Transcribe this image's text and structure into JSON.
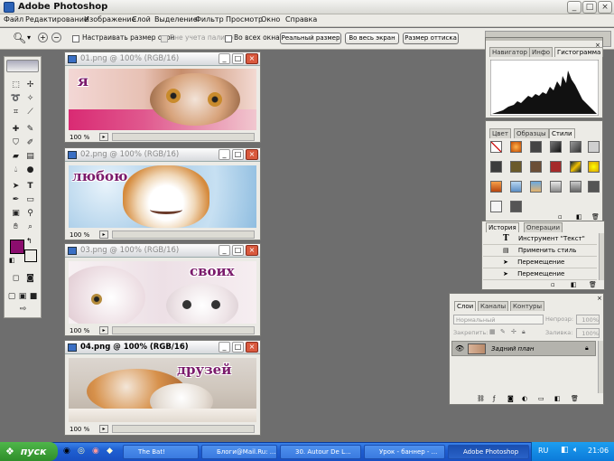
{
  "app": {
    "title": "Adobe Photoshop",
    "window_buttons": [
      "_",
      "□",
      "×"
    ]
  },
  "menu": [
    "Файл",
    "Редактирование",
    "Изображение",
    "Слой",
    "Выделение",
    "Фильтр",
    "Просмотр",
    "Окно",
    "Справка"
  ],
  "options_bar": {
    "resize_windows_label": "Настраивать размер окон",
    "ignore_palettes_label": "Вне учета палитр",
    "all_windows_label": "Во всех окнах",
    "actual_pixels": "Реальный размер",
    "fit_screen": "Во весь экран",
    "print_size": "Размер оттиска"
  },
  "documents": [
    {
      "title": "01.png @ 100% (RGB/16)",
      "zoom": "100 %",
      "caption": "я"
    },
    {
      "title": "02.png @ 100% (RGB/16)",
      "zoom": "100 %",
      "caption": "любою"
    },
    {
      "title": "03.png @ 100% (RGB/16)",
      "zoom": "100 %",
      "caption": "своих"
    },
    {
      "title": "04.png @ 100% (RGB/16)",
      "zoom": "100 %",
      "caption": "друзей"
    }
  ],
  "navigator_panel": {
    "tabs": [
      "Навигатор",
      "Инфо",
      "Гистограмма"
    ],
    "active": "Гистограмма"
  },
  "swatches_panel": {
    "tabs": [
      "Цвет",
      "Образцы",
      "Стили"
    ],
    "active": "Стили"
  },
  "history_panel": {
    "tabs": [
      "История",
      "Операции"
    ],
    "items": [
      "Инструмент \"Текст\"",
      "Применить стиль",
      "Перемещение",
      "Перемещение"
    ]
  },
  "layers_panel": {
    "tabs": [
      "Слои",
      "Каналы",
      "Контуры"
    ],
    "blend_mode": "Нормальный",
    "opacity_label": "Непрозр:",
    "opacity_value": "100%",
    "lock_label": "Закрепить:",
    "fill_label": "Заливка:",
    "fill_value": "100%",
    "layer_name": "Задний план"
  },
  "colors": {
    "foreground": "#8b0d6e",
    "background": "#ffffff",
    "desktop": "#6e6e6e",
    "caption_text": "#7a1a6b"
  },
  "taskbar": {
    "start": "пуск",
    "items": [
      "The Bat!",
      "Блоги@Mail.Ru: ...",
      "30. Autour De L...",
      "Урок - баннер - ...",
      "Adobe Photoshop"
    ],
    "active": "Adobe Photoshop",
    "lang": "RU",
    "clock": "21:06"
  }
}
